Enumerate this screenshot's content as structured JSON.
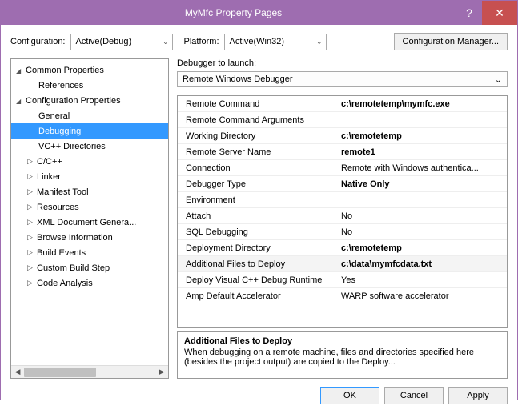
{
  "titlebar": {
    "title": "MyMfc Property Pages",
    "help": "?",
    "close": "✕"
  },
  "toprow": {
    "config_label": "Configuration:",
    "config_value": "Active(Debug)",
    "platform_label": "Platform:",
    "platform_value": "Active(Win32)",
    "config_mgr": "Configuration Manager..."
  },
  "tree": {
    "common": "Common Properties",
    "references": "References",
    "configprops": "Configuration Properties",
    "general": "General",
    "debugging": "Debugging",
    "vcdirs": "VC++ Directories",
    "cpp": "C/C++",
    "linker": "Linker",
    "manifest": "Manifest Tool",
    "resources": "Resources",
    "xmldoc": "XML Document Genera...",
    "browse": "Browse Information",
    "build": "Build Events",
    "custom": "Custom Build Step",
    "code": "Code Analysis"
  },
  "launch": {
    "label": "Debugger to launch:",
    "value": "Remote Windows Debugger"
  },
  "grid": [
    {
      "k": "Remote Command",
      "v": "c:\\remotetemp\\mymfc.exe",
      "bold": true
    },
    {
      "k": "Remote Command Arguments",
      "v": ""
    },
    {
      "k": "Working Directory",
      "v": "c:\\remotetemp",
      "bold": true
    },
    {
      "k": "Remote Server Name",
      "v": "remote1",
      "bold": true
    },
    {
      "k": "Connection",
      "v": "Remote with Windows authentica..."
    },
    {
      "k": "Debugger Type",
      "v": "Native Only",
      "bold": true
    },
    {
      "k": "Environment",
      "v": ""
    },
    {
      "k": "Attach",
      "v": "No"
    },
    {
      "k": "SQL Debugging",
      "v": "No"
    },
    {
      "k": "Deployment Directory",
      "v": "c:\\remotetemp",
      "bold": true
    },
    {
      "k": "Additional Files to Deploy",
      "v": "c:\\data\\mymfcdata.txt",
      "bold": true,
      "sel": true
    },
    {
      "k": "Deploy Visual C++ Debug Runtime",
      "v": "Yes"
    },
    {
      "k": "Amp Default Accelerator",
      "v": "WARP software accelerator"
    }
  ],
  "desc": {
    "title": "Additional Files to Deploy",
    "body": "When debugging on a remote machine, files and directories specified here (besides the project output) are copied to the Deploy..."
  },
  "footer": {
    "ok": "OK",
    "cancel": "Cancel",
    "apply": "Apply"
  }
}
